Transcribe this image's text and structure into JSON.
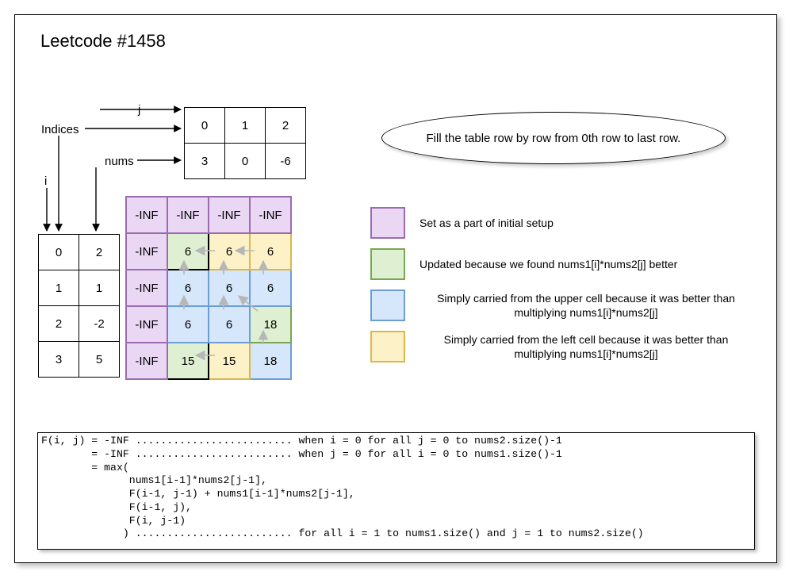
{
  "title": "Leetcode #1458",
  "labels": {
    "indices": "Indices",
    "nums": "nums",
    "i": "i",
    "j": "j"
  },
  "top_table": {
    "indices": [
      "0",
      "1",
      "2"
    ],
    "nums": [
      "3",
      "0",
      "-6"
    ]
  },
  "left_table": {
    "indices": [
      "0",
      "1",
      "2",
      "3"
    ],
    "nums": [
      "2",
      "1",
      "-2",
      "5"
    ]
  },
  "dp": {
    "cells": [
      [
        {
          "v": "-INF",
          "c": "purple"
        },
        {
          "v": "-INF",
          "c": "purple"
        },
        {
          "v": "-INF",
          "c": "purple"
        },
        {
          "v": "-INF",
          "c": "purple"
        }
      ],
      [
        {
          "v": "-INF",
          "c": "purple"
        },
        {
          "v": "6",
          "c": "green",
          "bk": true
        },
        {
          "v": "6",
          "c": "yellow"
        },
        {
          "v": "6",
          "c": "yellow"
        }
      ],
      [
        {
          "v": "-INF",
          "c": "purple"
        },
        {
          "v": "6",
          "c": "blue"
        },
        {
          "v": "6",
          "c": "blue"
        },
        {
          "v": "6",
          "c": "blue"
        }
      ],
      [
        {
          "v": "-INF",
          "c": "purple"
        },
        {
          "v": "6",
          "c": "blue"
        },
        {
          "v": "6",
          "c": "blue"
        },
        {
          "v": "18",
          "c": "green"
        }
      ],
      [
        {
          "v": "-INF",
          "c": "purple"
        },
        {
          "v": "15",
          "c": "green",
          "bk": true
        },
        {
          "v": "15",
          "c": "yellow"
        },
        {
          "v": "18",
          "c": "blue"
        }
      ]
    ]
  },
  "ellipse_text": "Fill the table row by row from 0th row to last row.",
  "legend": [
    {
      "c": "purple",
      "text": "Set as a part of initial setup"
    },
    {
      "c": "green",
      "text": "Updated because we found nums1[i]*nums2[j] better"
    },
    {
      "c": "blue",
      "text": "Simply carried from the upper cell because it was better than multiplying nums1[i]*nums2[j]"
    },
    {
      "c": "yellow",
      "text": "Simply carried from the left cell because it was better than multiplying nums1[i]*nums2[j]"
    }
  ],
  "code_lines": [
    "F(i, j) = -INF ......................... when i = 0 for all j = 0 to nums2.size()-1",
    "        = -INF ......................... when j = 0 for all i = 0 to nums1.size()-1",
    "        = max(",
    "              nums1[i-1]*nums2[j-1],",
    "              F(i-1, j-1) + nums1[i-1]*nums2[j-1],",
    "              F(i-1, j),",
    "              F(i, j-1)",
    "             ) ......................... for all i = 1 to nums1.size() and j = 1 to nums2.size()"
  ]
}
